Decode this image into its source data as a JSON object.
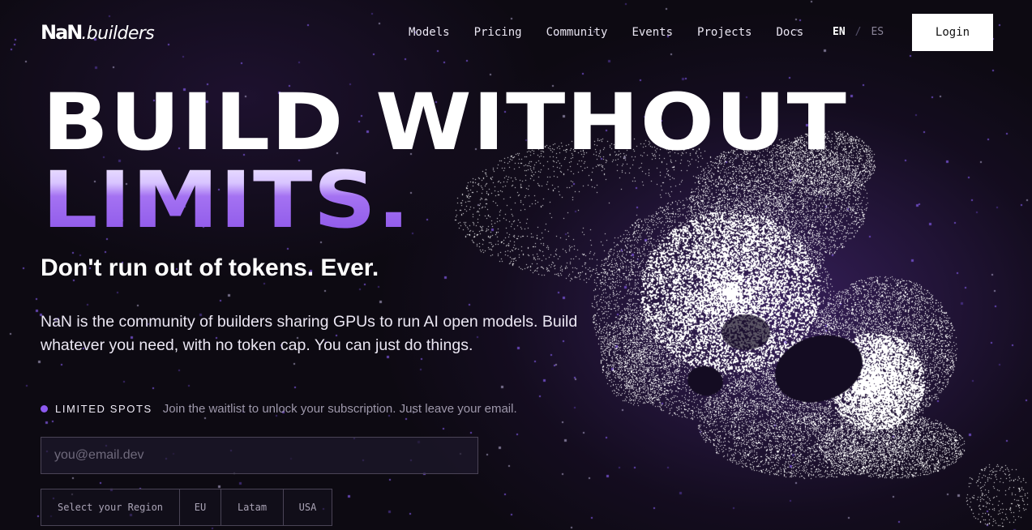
{
  "brand": {
    "mark": "NaN",
    "word": ".builders"
  },
  "nav": {
    "links": [
      "Models",
      "Pricing",
      "Community",
      "Events",
      "Projects",
      "Docs"
    ],
    "lang": {
      "active": "EN",
      "separator": "/",
      "inactive": "ES"
    },
    "login_label": "Login"
  },
  "hero": {
    "headline_line1": "BUILD WITHOUT",
    "headline_line2": "LIMITS.",
    "subheadline": "Don't run out of tokens. Ever.",
    "description": "NaN is the community of builders sharing GPUs to run AI open models. Build whatever you need, with no token cap. You can just do things."
  },
  "waitlist": {
    "badge": "LIMITED SPOTS",
    "text": "Join the waitlist to unlock your subscription. Just leave your email.",
    "email_placeholder": "you@email.dev",
    "email_value": "",
    "region_label": "Select your Region",
    "regions": [
      "EU",
      "Latam",
      "USA"
    ]
  },
  "colors": {
    "accent": "#8d5af0",
    "background": "#0d0a12",
    "headline_gradient_top": "#efe6ff",
    "headline_gradient_bottom": "#8c55e8"
  },
  "icons": {
    "status_dot": "purple-dot-icon",
    "hero_art": "particle-face-illustration"
  }
}
